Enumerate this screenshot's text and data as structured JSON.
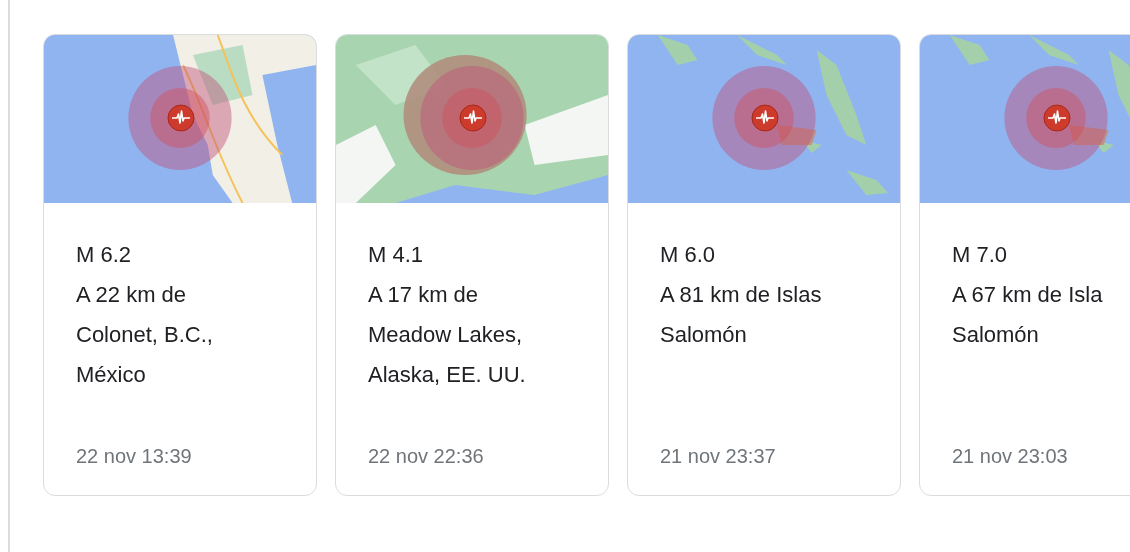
{
  "cards": [
    {
      "picture": {
        "kind": "picture"
      },
      "magnitude": "M 6.2",
      "place_lines": [
        "A 22 km de",
        "Colonet, B.C.,",
        "México"
      ],
      "time": "22 nov 13:39"
    },
    {
      "picture": {
        "kind": "picture"
      },
      "magnitude": "M 4.1",
      "place_lines": [
        "A 17 km de",
        "Meadow Lakes,",
        "Alaska, EE. UU."
      ],
      "time": "22 nov 22:36"
    },
    {
      "picture": {
        "kind": "picture"
      },
      "magnitude": "M 6.0",
      "place_lines": [
        "A 81 km de Islas",
        "Salomón"
      ],
      "time": "21 nov 23:37"
    },
    {
      "picture": {
        "kind": "picture"
      },
      "magnitude": "M 7.0",
      "place_lines": [
        "A 67 km de Isla",
        "Salomón"
      ],
      "time": "21 nov 23:03"
    }
  ]
}
